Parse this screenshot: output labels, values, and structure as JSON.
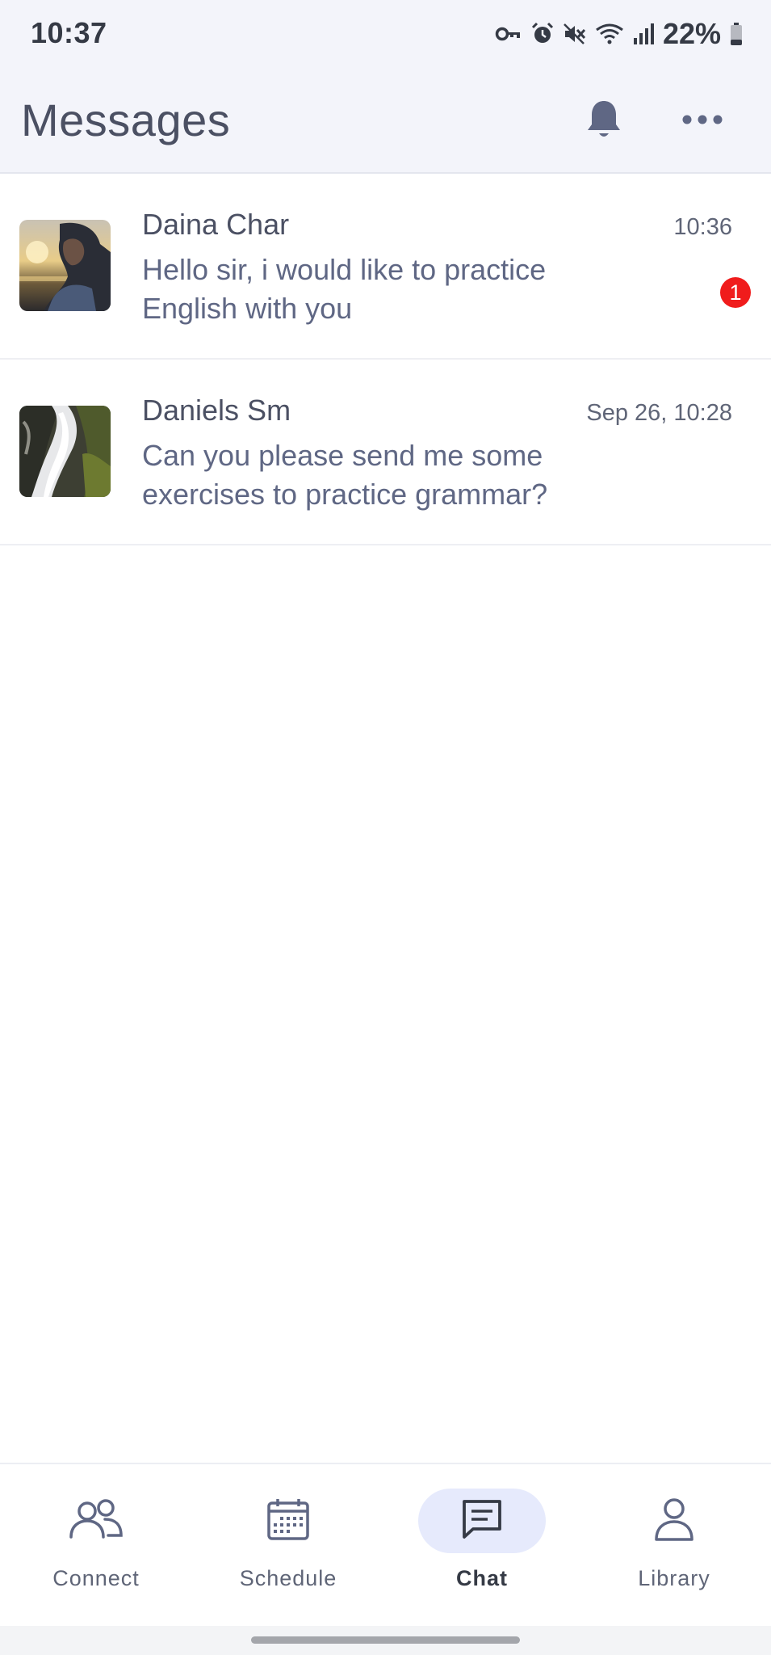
{
  "status_bar": {
    "time": "10:37",
    "battery": "22%",
    "icons": [
      "vpn-key-icon",
      "alarm-icon",
      "mute-icon",
      "wifi-icon",
      "signal-icon",
      "battery-icon"
    ]
  },
  "header": {
    "title": "Messages",
    "bell_icon": "bell-icon",
    "more_icon": "more-horizontal-icon"
  },
  "conversations": [
    {
      "name": "Daina Char",
      "time": "10:36",
      "preview": "Hello sir, i would like to practice English with you",
      "unread": "1"
    },
    {
      "name": "Daniels Sm",
      "time": "Sep 26, 10:28",
      "preview": "Can you please send me some exercises to practice grammar?"
    }
  ],
  "bottom_nav": {
    "active": "Chat",
    "items": [
      {
        "label": "Connect",
        "icon": "people-icon"
      },
      {
        "label": "Schedule",
        "icon": "calendar-icon"
      },
      {
        "label": "Chat",
        "icon": "chat-icon"
      },
      {
        "label": "Library",
        "icon": "person-icon"
      }
    ]
  },
  "colors": {
    "header_bg": "#f3f4fa",
    "text_primary": "#4b5063",
    "text_secondary": "#5f6784",
    "badge_red": "#f01c1c",
    "nav_active_bg": "#e6eafc"
  }
}
